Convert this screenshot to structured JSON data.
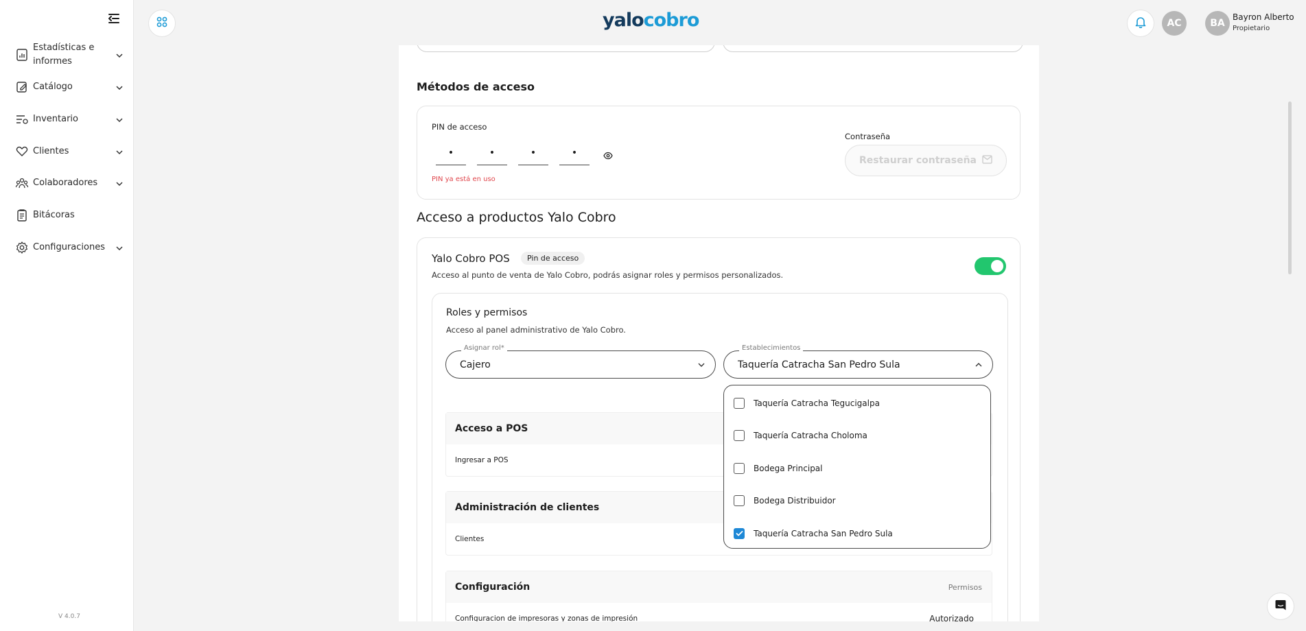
{
  "sidebar": {
    "items": [
      {
        "label": "Estadísticas e informes",
        "icon": "chart-report-icon",
        "expandable": true
      },
      {
        "label": "Catálogo",
        "icon": "catalog-edit-icon",
        "expandable": true
      },
      {
        "label": "Inventario",
        "icon": "inventory-filter-icon",
        "expandable": true
      },
      {
        "label": "Clientes",
        "icon": "handshake-heart-icon",
        "expandable": true
      },
      {
        "label": "Colaboradores",
        "icon": "people-group-icon",
        "expandable": true
      },
      {
        "label": "Bitácoras",
        "icon": "clipboard-log-icon",
        "expandable": false
      },
      {
        "label": "Configuraciones",
        "icon": "gear-icon",
        "expandable": true
      }
    ],
    "version": "V 4.0.7"
  },
  "header": {
    "logo_part1": "yalo",
    "logo_part2": "cobro",
    "avatar_initials": "AC",
    "user": {
      "initials": "BA",
      "name": "Bayron Alberto",
      "role": "Propietario"
    }
  },
  "access_methods": {
    "title": "Métodos de acceso",
    "pin_label": "PIN de acceso",
    "pin_digits": [
      "•",
      "•",
      "•",
      "•"
    ],
    "pin_error": "PIN ya está en uso",
    "password_label": "Contraseña",
    "restore_button": "Restaurar contraseña"
  },
  "products": {
    "title": "Acceso a productos Yalo Cobro",
    "pos": {
      "name": "Yalo Cobro POS",
      "badge": "Pin de acceso",
      "description": "Acceso al punto de venta de Yalo Cobro, podrás asignar roles y permisos personalizados.",
      "enabled": true
    },
    "roles": {
      "title": "Roles y permisos",
      "description": "Acceso al panel administrativo de Yalo Cobro.",
      "role_label": "Asignar rol*",
      "role_value": "Cajero",
      "stores_label": "Establecimientos",
      "stores_value": "Taquería Catracha San Pedro Sula"
    },
    "permissions": [
      {
        "title": "Acceso a POS",
        "header_right": "",
        "rows": [
          {
            "label": "Ingresar a POS",
            "value": ""
          }
        ]
      },
      {
        "title": "Administración de clientes",
        "header_right": "",
        "rows": [
          {
            "label": "Clientes",
            "value": ""
          }
        ]
      },
      {
        "title": "Configuración",
        "header_right": "Permisos",
        "rows": [
          {
            "label": "Configuracion de impresoras y zonas de impresión",
            "value": "Autorizado"
          }
        ]
      }
    ]
  },
  "stores_dropdown": {
    "options": [
      {
        "label": "Taquería Catracha Tegucigalpa",
        "checked": false
      },
      {
        "label": "Taquería Catracha Choloma",
        "checked": false
      },
      {
        "label": "Bodega Principal",
        "checked": false
      },
      {
        "label": "Bodega Distribuidor",
        "checked": false
      },
      {
        "label": "Taquería Catracha San Pedro Sula",
        "checked": true
      }
    ]
  },
  "colors": {
    "accent": "#1c9bd6",
    "toggle_on": "#22c66e",
    "error": "#e0454b",
    "checkbox": "#1e88d6"
  }
}
